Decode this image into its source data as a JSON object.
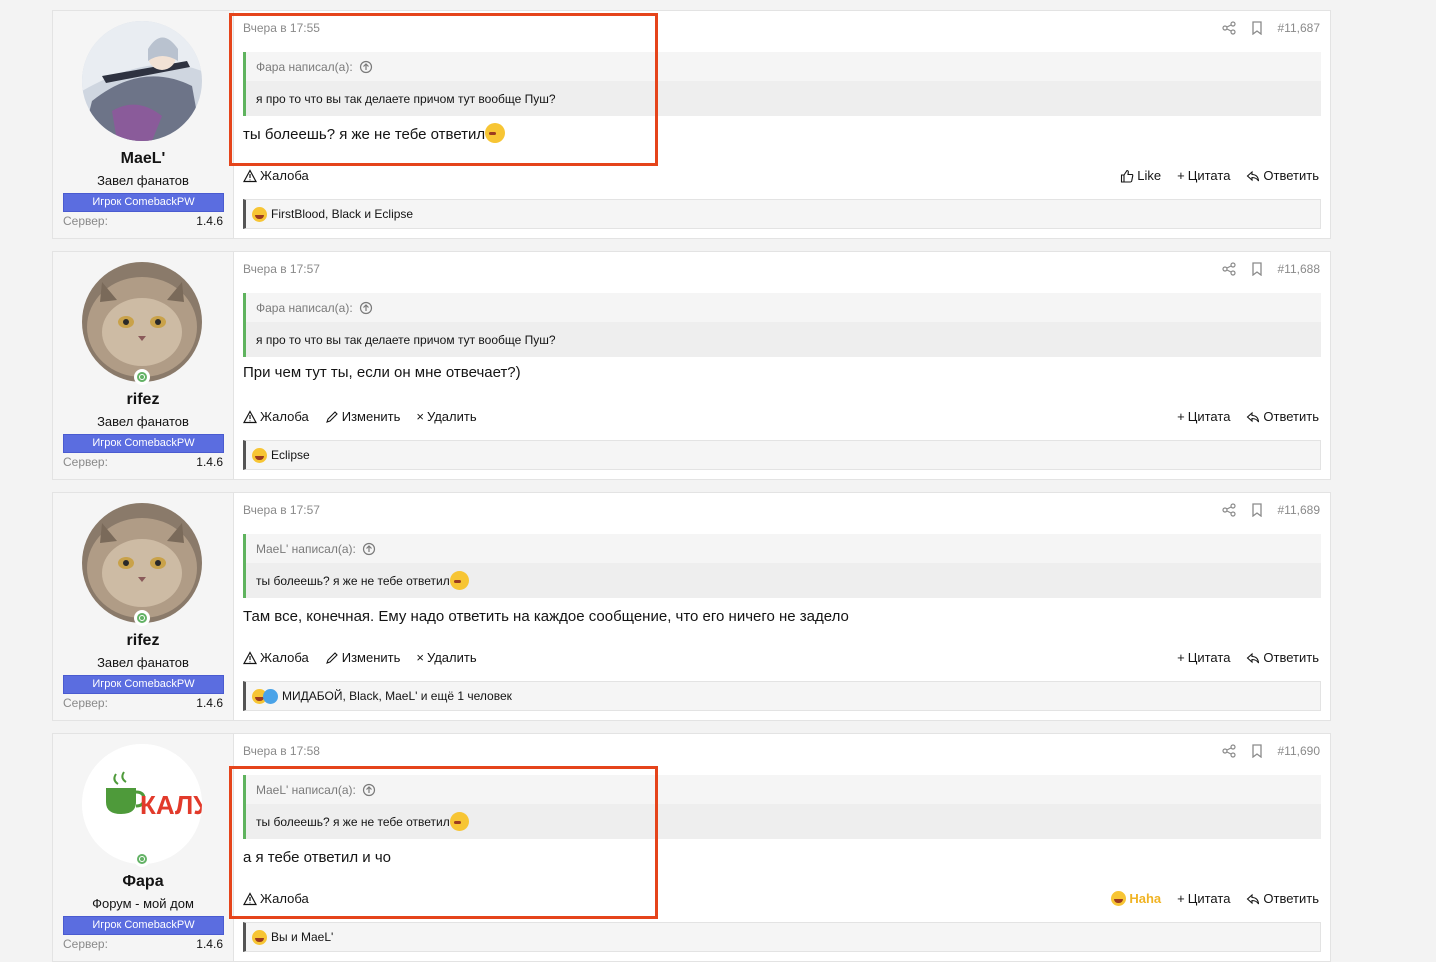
{
  "posts": [
    {
      "author": "MaeL'",
      "user_title": "Завел фанатов",
      "banner": "Игрок ComebackPW",
      "server_label": "Сервер:",
      "server_value": "1.4.6",
      "date": "Вчера в 17:55",
      "post_number": "#11,687",
      "quote_author": "Фара написал(а):",
      "quote_text": "я про то что вы так делаете причом тут вообще Пуш?",
      "message": "ты болеешь? я же не тебе ответил",
      "actions_left": [
        "Жалоба"
      ],
      "actions_right": [
        "Like",
        "Цитата",
        "Ответить"
      ],
      "reactions": "FirstBlood, Black и Eclipse"
    },
    {
      "author": "rifez",
      "user_title": "Завел фанатов",
      "banner": "Игрок ComebackPW",
      "server_label": "Сервер:",
      "server_value": "1.4.6",
      "date": "Вчера в 17:57",
      "post_number": "#11,688",
      "quote_author": "Фара написал(а):",
      "quote_text": "я про то что вы так делаете причом тут вообще Пуш?",
      "message": "При чем тут ты, если он мне отвечает?)",
      "actions_left": [
        "Жалоба",
        "Изменить",
        "Удалить"
      ],
      "actions_right": [
        "Цитата",
        "Ответить"
      ],
      "reactions": "Eclipse"
    },
    {
      "author": "rifez",
      "user_title": "Завел фанатов",
      "banner": "Игрок ComebackPW",
      "server_label": "Сервер:",
      "server_value": "1.4.6",
      "date": "Вчера в 17:57",
      "post_number": "#11,689",
      "quote_author": "MaeL' написал(а):",
      "quote_text": "ты болеешь? я же не тебе ответил",
      "message": "Там все, конечная. Ему надо ответить на каждое сообщение, что его ничего не задело",
      "actions_left": [
        "Жалоба",
        "Изменить",
        "Удалить"
      ],
      "actions_right": [
        "Цитата",
        "Ответить"
      ],
      "reactions": "МИДАБОЙ, Black, MaeL' и ещё 1 человек"
    },
    {
      "author": "Фара",
      "user_title": "Форум - мой дом",
      "banner": "Игрок ComebackPW",
      "server_label": "Сервер:",
      "server_value": "1.4.6",
      "date": "Вчера в 17:58",
      "post_number": "#11,690",
      "quote_author": "MaeL' написал(а):",
      "quote_text": "ты болеешь? я же не тебе ответил",
      "message": "а я тебе ответил и чо",
      "actions_left": [
        "Жалоба"
      ],
      "reaction_given": "Haha",
      "actions_right": [
        "Цитата",
        "Ответить"
      ],
      "reactions": "Вы и MaeL'"
    }
  ],
  "avatar_logo_text": "КАЛУЧАЯ",
  "colors": {
    "highlight": "#e5441b",
    "banner": "#5b6de0",
    "quote_bar": "#5fb35e",
    "online": "#63b265",
    "haha": "#f0b323"
  }
}
